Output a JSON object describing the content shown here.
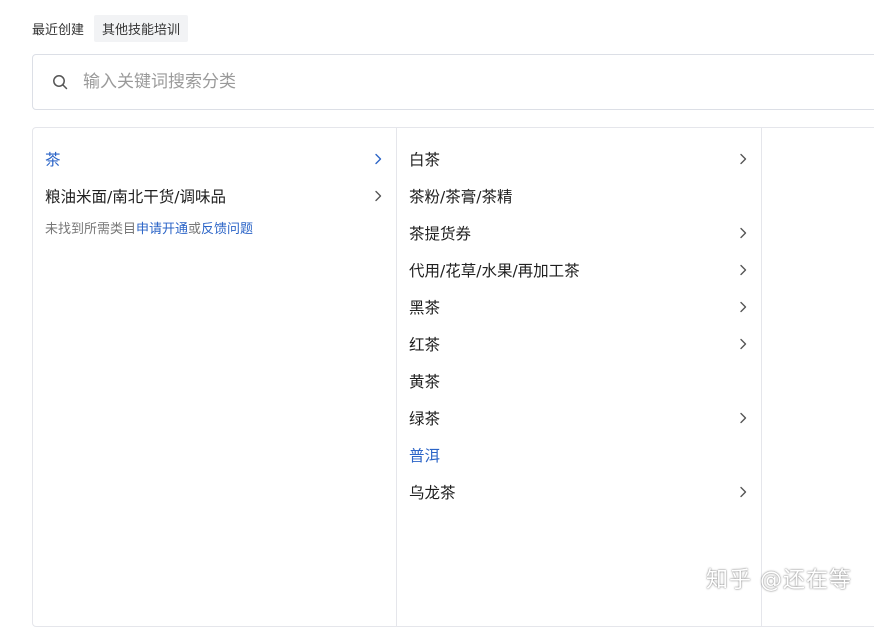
{
  "recent": {
    "label": "最近创建",
    "tags": [
      "其他技能培训"
    ]
  },
  "search": {
    "placeholder": "输入关键词搜索分类"
  },
  "colors": {
    "accent": "#2b64c7",
    "border": "#e5e6eb"
  },
  "level1": {
    "items": [
      {
        "label": "茶",
        "active": true,
        "has_children": true
      },
      {
        "label": "粮油米面/南北干货/调味品",
        "active": false,
        "has_children": true
      }
    ],
    "hint": {
      "prefix": "未找到所需类目",
      "apply_link": "申请开通",
      "or": "或",
      "feedback_link": "反馈问题"
    }
  },
  "level2": {
    "items": [
      {
        "label": "白茶",
        "active": false,
        "has_children": true
      },
      {
        "label": "茶粉/茶膏/茶精",
        "active": false,
        "has_children": false
      },
      {
        "label": "茶提货券",
        "active": false,
        "has_children": true
      },
      {
        "label": "代用/花草/水果/再加工茶",
        "active": false,
        "has_children": true
      },
      {
        "label": "黑茶",
        "active": false,
        "has_children": true
      },
      {
        "label": "红茶",
        "active": false,
        "has_children": true
      },
      {
        "label": "黄茶",
        "active": false,
        "has_children": false
      },
      {
        "label": "绿茶",
        "active": false,
        "has_children": true
      },
      {
        "label": "普洱",
        "active": true,
        "has_children": false
      },
      {
        "label": "乌龙茶",
        "active": false,
        "has_children": true
      }
    ]
  },
  "watermark": "知乎 @还在等"
}
